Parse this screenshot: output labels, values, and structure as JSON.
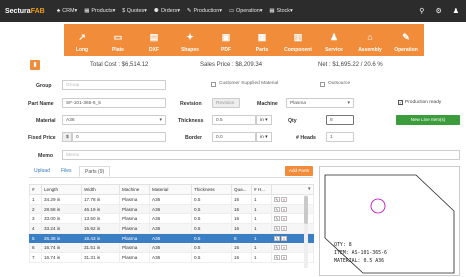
{
  "nav": {
    "brand_a": "Sectura",
    "brand_b": "FAB",
    "items": [
      "CRM▾",
      "Products▾",
      "$ Quotes▾",
      "Orders▾",
      "Production▾",
      "Operation▾",
      "Stock▾"
    ],
    "icons": [
      "home-icon",
      "box-icon",
      "dollar-icon",
      "cart-icon",
      "wrench-icon",
      "monitor-icon",
      "grid-icon"
    ]
  },
  "categories": [
    {
      "label": "Long",
      "icon": "↗"
    },
    {
      "label": "Plate",
      "icon": "▭"
    },
    {
      "label": "DXF",
      "icon": "▤"
    },
    {
      "label": "Shapes",
      "icon": "✦"
    },
    {
      "label": "PDF",
      "icon": "▣"
    },
    {
      "label": "Parts",
      "icon": "▦"
    },
    {
      "label": "Component",
      "icon": "▥"
    },
    {
      "label": "Service",
      "icon": "♟"
    },
    {
      "label": "Assembly",
      "icon": "⌂"
    },
    {
      "label": "Operation",
      "icon": "✎"
    }
  ],
  "summary": {
    "total_cost": "Total Cost : $6,514.12",
    "sales_price": "Sales Price : $8,209.34",
    "net": "Net : $1,695.22 / 20.6 %"
  },
  "form": {
    "group_label": "Group",
    "group_placeholder": "Group",
    "customer_supplied": "Customer Supplied Material",
    "outsource": "Outsource",
    "part_name_label": "Part Name",
    "part_name": "SF-101-365-6_5",
    "revision_label": "Revision",
    "revision_placeholder": "Revision",
    "machine_label": "Machine",
    "machine": "Plasma",
    "production_ready": "Production ready",
    "material_label": "Material",
    "material": "A36",
    "thickness_label": "Thickness",
    "thickness": "0.5",
    "thickness_unit": "in ▾",
    "qty_label": "Qty",
    "qty": "8",
    "new_line_button": "New Line Item(s)",
    "fixed_price_label": "Fixed Price",
    "currency": "$",
    "fixed_price": "0",
    "border_label": "Border",
    "border": "0.0",
    "border_unit": "in ▾",
    "heads_label": "# Heads",
    "heads": "1",
    "memo_label": "Memo",
    "memo_placeholder": "Memo"
  },
  "tabs": [
    "Upload",
    "Files",
    "Parts (9)"
  ],
  "add_parts_button": "Add Parts",
  "table": {
    "headers": [
      "#",
      "Length",
      "Width",
      "Machine",
      "Material",
      "Thickness",
      "Qua...",
      "# H...",
      ""
    ],
    "rows": [
      [
        "1",
        "34.29 in",
        "17.78 in",
        "Plasma",
        "A36",
        "0.5",
        "16",
        "1"
      ],
      [
        "2",
        "28.58 in",
        "46.19 in",
        "Plasma",
        "A36",
        "0.5",
        "16",
        "1"
      ],
      [
        "3",
        "33.00 in",
        "13.50 in",
        "Plasma",
        "A36",
        "0.5",
        "16",
        "1"
      ],
      [
        "4",
        "33.24 in",
        "15.92 in",
        "Plasma",
        "A36",
        "0.5",
        "16",
        "1"
      ],
      [
        "5",
        "26.38 in",
        "16.43 in",
        "Plasma",
        "A36",
        "0.5",
        "8",
        "1"
      ],
      [
        "6",
        "16.74 in",
        "31.51 in",
        "Plasma",
        "A36",
        "0.5",
        "16",
        "1"
      ],
      [
        "7",
        "16.74 in",
        "31.31 in",
        "Plasma",
        "A36",
        "0.5",
        "16",
        "1"
      ]
    ],
    "selected_row": 4
  },
  "preview": {
    "qty": "QTY: 8",
    "item": "ITEM: AS-101-365-6",
    "material": "MATERIAL: 0.5 A36"
  },
  "colors": {
    "accent": "#f08c3a",
    "nav": "#2c2c2c",
    "selected": "#3a7fc4",
    "green": "#3b9c3b"
  }
}
